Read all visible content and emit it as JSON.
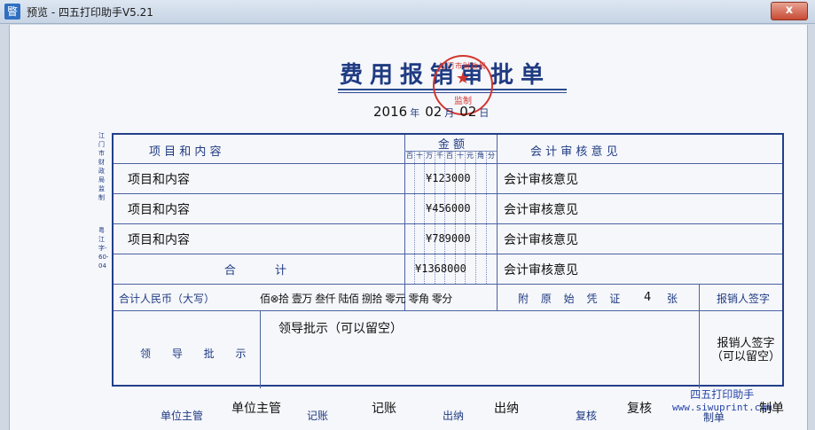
{
  "window": {
    "title": "预览 - 四五打印助手V5.21",
    "app_icon_glyph": "睯",
    "close_glyph": "x"
  },
  "document": {
    "title": "费用报销审批单",
    "date": {
      "year": "2016",
      "year_unit": "年",
      "month": "02",
      "month_unit": "月",
      "day": "02",
      "day_unit": "日"
    },
    "seal": {
      "text": "监制",
      "arc_text": "江门市财政局",
      "color": "#d2372f"
    },
    "side_note": "江门市财政局监制",
    "side_code": "粤 江字-60-04"
  },
  "table": {
    "headers": {
      "item": "项 目 和 内 容",
      "amount": "金 额",
      "audit": "会 计 审 核 意 见",
      "digits": [
        "百",
        "十",
        "万",
        "千",
        "百",
        "十",
        "元",
        "角",
        "分"
      ]
    },
    "rows": [
      {
        "item": "项目和内容",
        "amount": "¥123000",
        "audit": "会计审核意见"
      },
      {
        "item": "项目和内容",
        "amount": "¥456000",
        "audit": "会计审核意见"
      },
      {
        "item": "项目和内容",
        "amount": "¥789000",
        "audit": "会计审核意见"
      }
    ],
    "total": {
      "label": "合 计",
      "amount": "¥1368000",
      "audit": "会计审核意见"
    },
    "rmb": {
      "label": "合计人民币（大写）",
      "text": "佰⊗拾 壹万 叁仟 陆佰 捌拾 零元 零角 零分"
    },
    "attachments": {
      "label": "附 原 始 凭 证",
      "count": "4",
      "unit": "张"
    },
    "signer": {
      "label": "报销人签字",
      "value": "报销人签字（可以留空）"
    },
    "approval": {
      "label": "领 导 批 示",
      "value": "领导批示（可以留空）"
    }
  },
  "footer": {
    "unit_head_label": "单位主管",
    "unit_head_value": "单位主管",
    "bookkeeper_label": "记账",
    "bookkeeper_value": "记账",
    "cashier_label": "出纳",
    "cashier_value": "出纳",
    "reviewer_label": "复核",
    "reviewer_value": "复核",
    "maker_label": "制单",
    "maker_value": "制单"
  },
  "watermark": {
    "name": "四五打印助手",
    "site": "www.siwuprint.com"
  }
}
